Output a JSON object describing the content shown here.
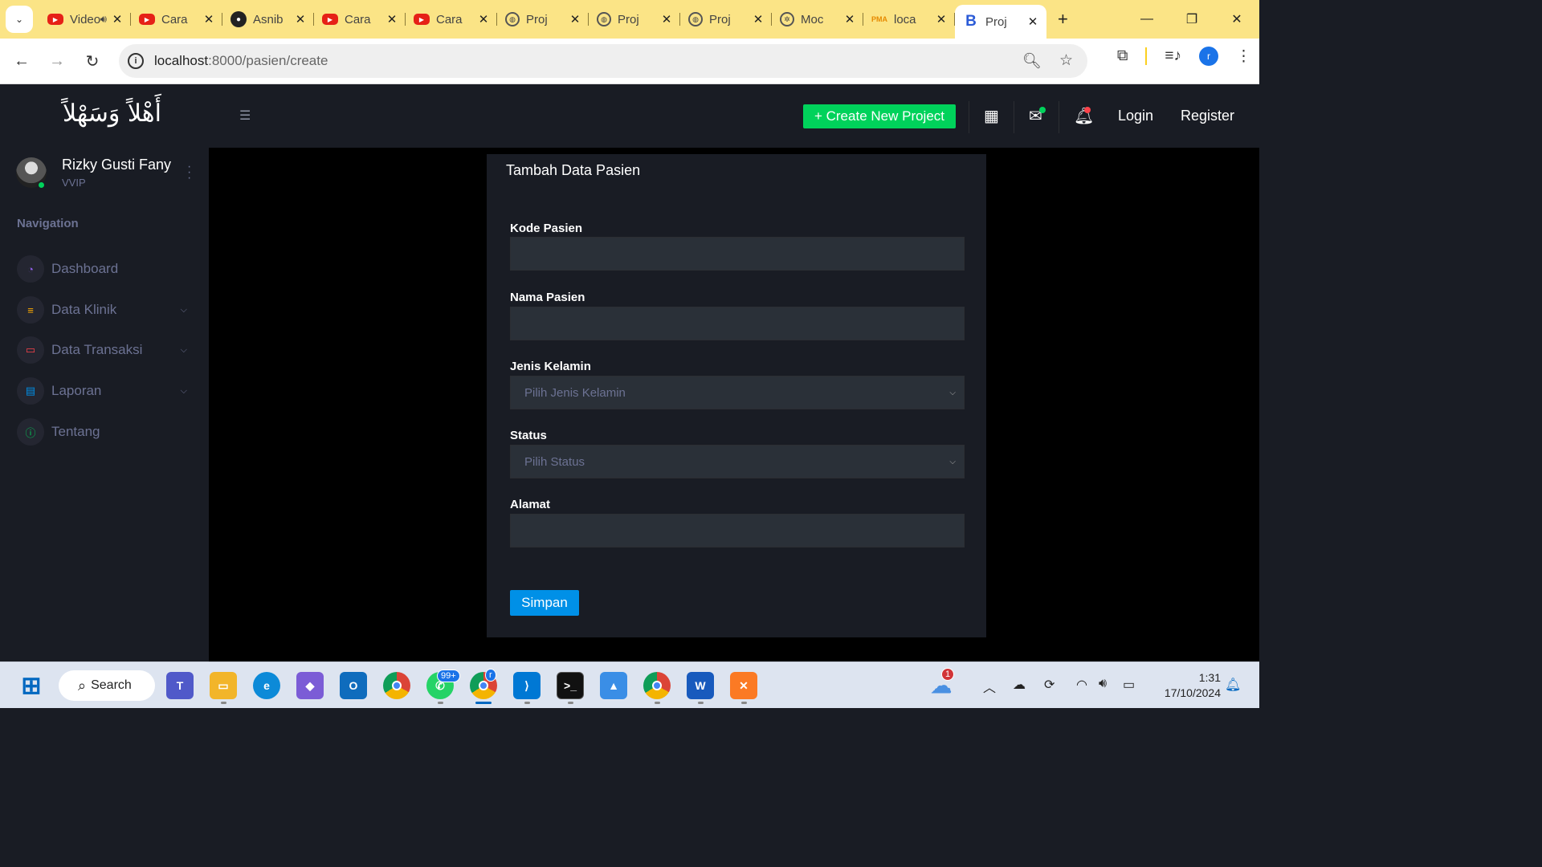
{
  "browser": {
    "tabs": [
      {
        "title": "Video",
        "icon": "youtube-icon"
      },
      {
        "title": "Cara",
        "icon": "youtube-icon"
      },
      {
        "title": "Asnib",
        "icon": "github-icon"
      },
      {
        "title": "Cara",
        "icon": "youtube-icon"
      },
      {
        "title": "Cara",
        "icon": "youtube-icon"
      },
      {
        "title": "Proj",
        "icon": "globe-icon"
      },
      {
        "title": "Proj",
        "icon": "globe-icon"
      },
      {
        "title": "Proj",
        "icon": "globe-icon"
      },
      {
        "title": "Moc",
        "icon": "openai-icon"
      },
      {
        "title": "loca",
        "icon": "phpmyadmin-icon"
      },
      {
        "title": "Proj",
        "icon": "bootstrap-icon",
        "active": true
      }
    ],
    "url_host": "localhost",
    "url_rest": ":8000/pasien/create",
    "profile_initial": "r"
  },
  "topbar": {
    "brand": "أَهْلاً وَسَهْلاً",
    "create_label": "+ Create New Project",
    "login_label": "Login",
    "register_label": "Register"
  },
  "user": {
    "name": "Rizky Gusti Fany",
    "role": "VVIP"
  },
  "sidebar": {
    "heading": "Navigation",
    "items": [
      {
        "label": "Dashboard",
        "icon": "speedometer-icon",
        "color": "#8f5fe8",
        "has_children": false
      },
      {
        "label": "Data Klinik",
        "icon": "database-icon",
        "color": "#ffab00",
        "has_children": true
      },
      {
        "label": "Data Transaksi",
        "icon": "ticket-icon",
        "color": "#fc424a",
        "has_children": true
      },
      {
        "label": "Laporan",
        "icon": "clipboard-icon",
        "color": "#0090e7",
        "has_children": true
      },
      {
        "label": "Tentang",
        "icon": "info-icon",
        "color": "#00d25b",
        "has_children": false
      }
    ]
  },
  "form": {
    "title": "Tambah Data Pasien",
    "fields": {
      "kode": {
        "label": "Kode Pasien",
        "value": ""
      },
      "nama": {
        "label": "Nama Pasien",
        "value": ""
      },
      "jenis_kelamin": {
        "label": "Jenis Kelamin",
        "placeholder": "Pilih Jenis Kelamin"
      },
      "status": {
        "label": "Status",
        "placeholder": "Pilih Status"
      },
      "alamat": {
        "label": "Alamat",
        "value": ""
      }
    },
    "submit_label": "Simpan"
  },
  "taskbar": {
    "search_label": "Search",
    "whatsapp_badge": "99+",
    "chrome_badge": "r",
    "weather_badge": "1",
    "time": "1:31",
    "date": "17/10/2024"
  }
}
